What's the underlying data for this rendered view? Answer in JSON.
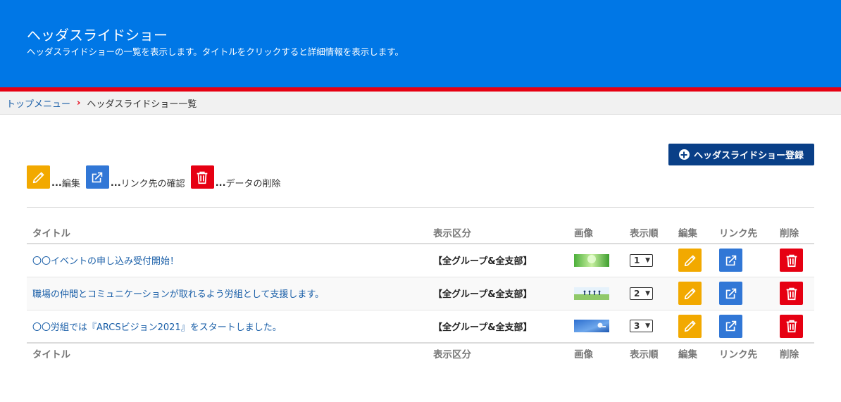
{
  "header": {
    "title": "ヘッダスライドショー",
    "description": "ヘッダスライドショーの一覧を表示します。タイトルをクリックすると詳細情報を表示します。"
  },
  "breadcrumb": {
    "home": "トップメニュー",
    "current": "ヘッダスライドショー一覧"
  },
  "actions": {
    "register_label": "ヘッダスライドショー登録"
  },
  "legend": {
    "edit": "編集",
    "link": "リンク先の確認",
    "delete": "データの削除",
    "dots": "..."
  },
  "table": {
    "columns": [
      "タイトル",
      "表示区分",
      "画像",
      "表示順",
      "編集",
      "リンク先",
      "削除"
    ],
    "rows": [
      {
        "title": "〇〇イベントの申し込み受付開始！",
        "category": "【全グループ&全支部】",
        "order": "1"
      },
      {
        "title": "職場の仲間とコミュニケーションが取れるよう労組として支援します。",
        "category": "【全グループ&全支部】",
        "order": "2"
      },
      {
        "title": "〇〇労組では『ARCSビジョン2021』をスタートしました。",
        "category": "【全グループ&全支部】",
        "order": "3"
      }
    ]
  },
  "colors": {
    "header_bg": "#0077e6",
    "accent_red": "#e60012",
    "register_btn": "#093f87",
    "edit_icon": "#f2a900",
    "link_icon": "#3177d6",
    "delete_icon": "#e60012"
  }
}
